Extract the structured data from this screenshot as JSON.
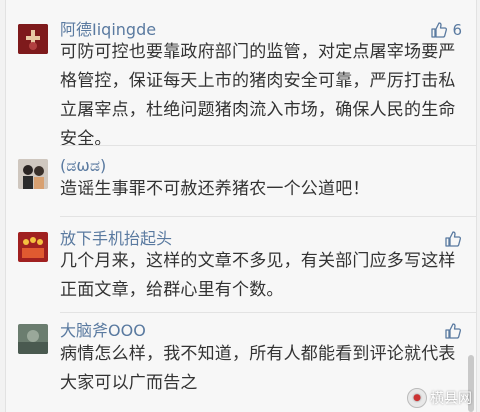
{
  "comments": [
    {
      "name": "阿德Iiqingde",
      "likes": "6",
      "text": "可防可控也要靠政府部门的监管，对定点屠宰场要严格管控，保证每天上市的猪肉安全可靠，严厉打击私立屠宰点，杜绝问题猪肉流入市场，确保人民的生命安全。"
    },
    {
      "name": "(ಡωಡ)",
      "likes": "",
      "text": "造谣生事罪不可赦还养猪农一个公道吧！"
    },
    {
      "name": "放下手机抬起头",
      "likes": "",
      "text": "几个月来，这样的文章不多见，有关部门应多写这样正面文章，给群心里有个数。"
    },
    {
      "name": "大脑斧OOO",
      "likes": "",
      "text": "病情怎么样，我不知道，所有人都能看到评论就代表大家可以广而告之"
    }
  ],
  "watermark": "横县网",
  "icons": {
    "like": "thumbs-up-icon"
  },
  "colors": {
    "name": "#5a7aa0",
    "text": "#333333",
    "background": "#f7f7f7"
  }
}
